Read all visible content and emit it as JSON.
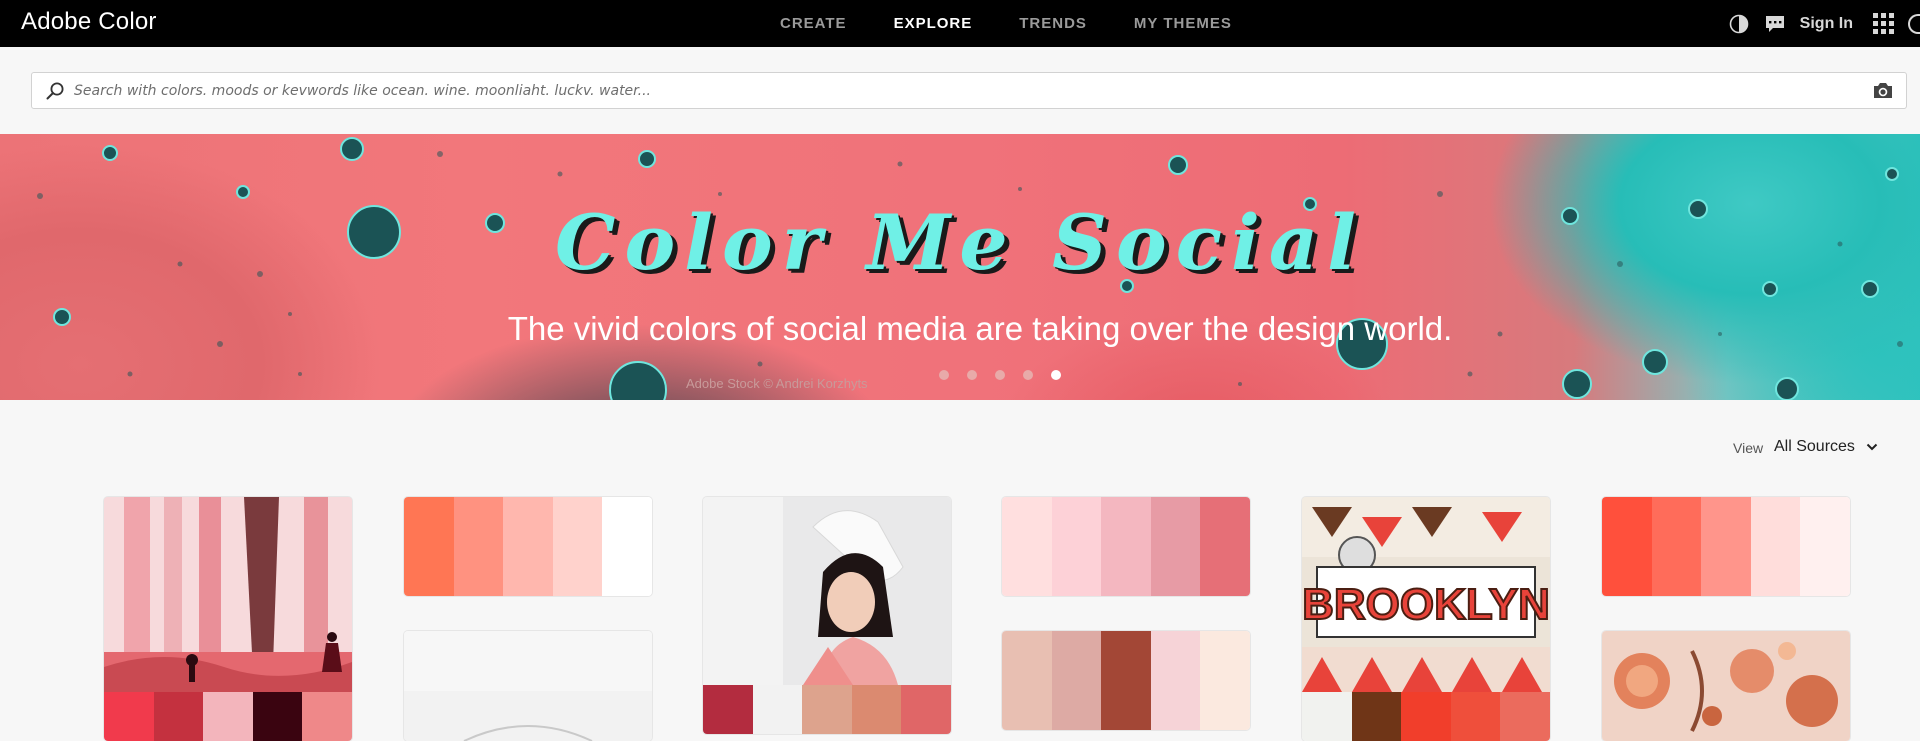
{
  "app": {
    "title": "Adobe Color"
  },
  "nav": {
    "items": [
      {
        "label": "CREATE",
        "active": false
      },
      {
        "label": "EXPLORE",
        "active": true
      },
      {
        "label": "TRENDS",
        "active": false
      },
      {
        "label": "MY THEMES",
        "active": false
      }
    ]
  },
  "header_right": {
    "icons": [
      "theme-toggle-icon",
      "feedback-icon",
      "apps-grid-icon"
    ],
    "signin_label": "Sign In"
  },
  "search": {
    "placeholder": "Search with colors. moods or kevwords like ocean. wine. moonliaht. luckv. water...",
    "value": ""
  },
  "hero": {
    "title": "Color Me Social",
    "subtitle": "The vivid colors of social media are taking over the design world.",
    "credit": "Adobe Stock  ©  Andrei Korzhyts",
    "slides": 5,
    "active_slide": 5,
    "colors": {
      "title": "#6ff0e6",
      "coral": "#ee7276",
      "teal": "#2fc3bd"
    }
  },
  "view": {
    "label": "View",
    "selected": "All Sources"
  },
  "themes": {
    "col1_forest": {
      "image": "forest-illustration-image",
      "swatches": [
        "#f13a4c",
        "#c4313f",
        "#f3b5bc",
        "#3a0410",
        "#ef8889"
      ]
    },
    "col2_top": {
      "swatches": [
        "#ff7654",
        "#ff9280",
        "#ffb7ae",
        "#ffd2cc",
        "#ffffff"
      ]
    },
    "col2_bottom": {
      "image": "white-vase-image"
    },
    "col3_portrait": {
      "image": "woman-portrait-image",
      "swatches": [
        "#b32c3f",
        "#f2f2f2",
        "#dda38d",
        "#db8a70",
        "#e06667"
      ]
    },
    "col4_top": {
      "swatches": [
        "#ffdfdf",
        "#fdd1d7",
        "#f4b7c0",
        "#e79ba5",
        "#e66f77"
      ]
    },
    "col4_bottom": {
      "swatches": [
        "#e8bfb2",
        "#ddaaa4",
        "#a34736",
        "#f6d3d7",
        "#fbe9df"
      ]
    },
    "col5_brooklyn": {
      "image": "brooklyn-sign-image",
      "swatches": [
        "#f1f2ef",
        "#6f3517",
        "#f13e2b",
        "#ef4f3b",
        "#eb6b5d"
      ]
    },
    "col6_top": {
      "swatches": [
        "#ff503c",
        "#ff6c5a",
        "#ff958b",
        "#ffdddb",
        "#fff0ef"
      ]
    },
    "col6_bottom": {
      "image": "autumn-illustration-image"
    }
  }
}
